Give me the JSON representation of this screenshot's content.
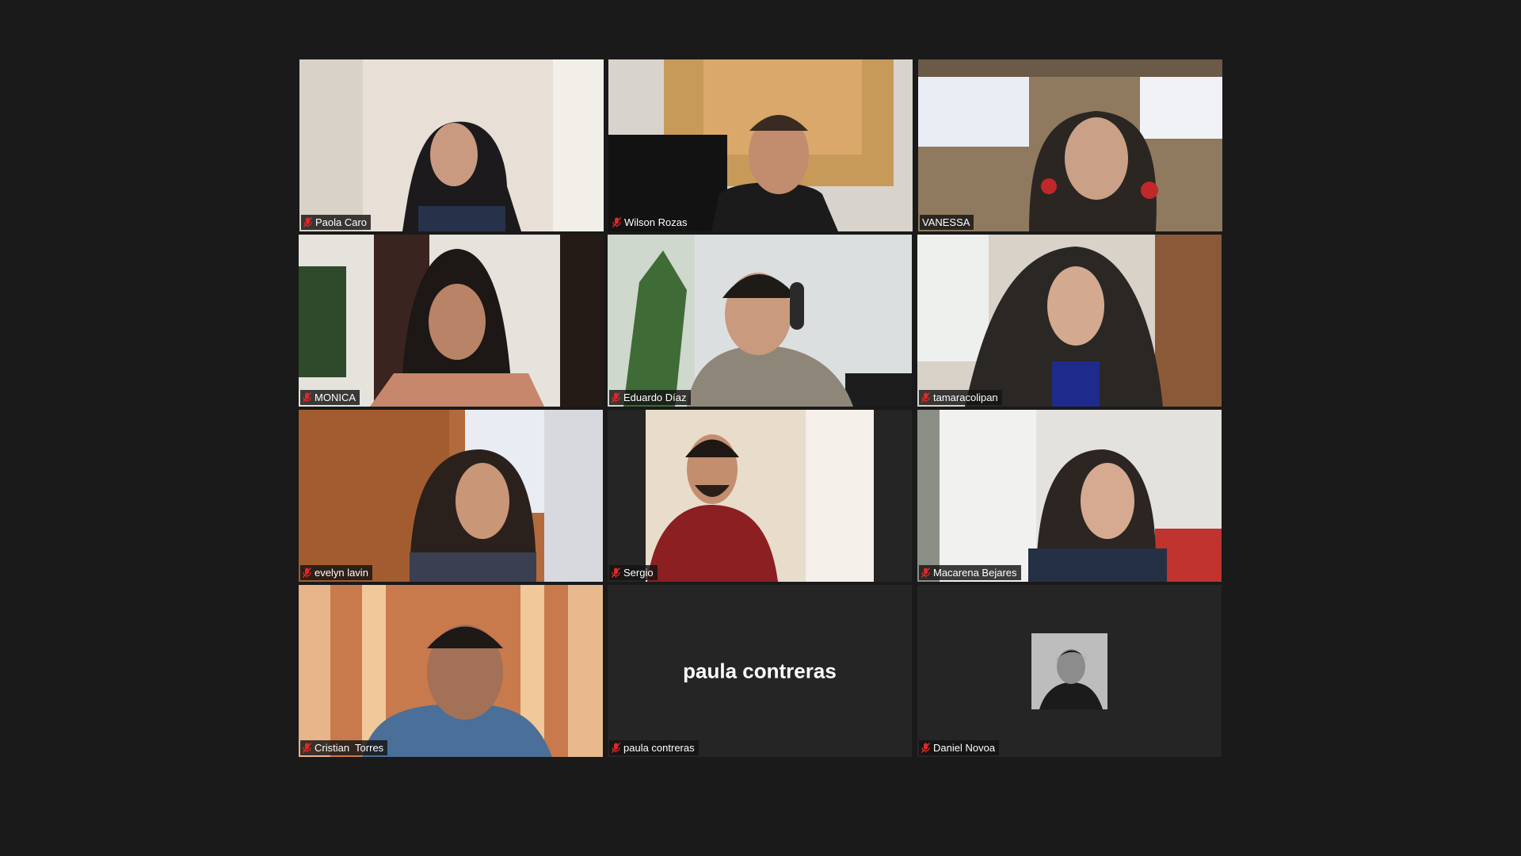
{
  "participants": [
    {
      "name": "Paola Caro",
      "muted": true,
      "video": true
    },
    {
      "name": "Wilson Rozas",
      "muted": true,
      "video": true
    },
    {
      "name": "VANESSA",
      "muted": false,
      "video": true
    },
    {
      "name": "MONICA",
      "muted": true,
      "video": true
    },
    {
      "name": "Eduardo Díaz",
      "muted": true,
      "video": true
    },
    {
      "name": "tamaracolipan",
      "muted": true,
      "video": true
    },
    {
      "name": "evelyn lavin",
      "muted": true,
      "video": true
    },
    {
      "name": "Sergio",
      "muted": true,
      "video": true
    },
    {
      "name": "Macarena Bejares",
      "muted": true,
      "video": true
    },
    {
      "name": "Cristian  Torres",
      "muted": true,
      "video": true
    },
    {
      "name": "paula contreras",
      "muted": true,
      "video": false,
      "display_text": "paula contreras"
    },
    {
      "name": "Daniel Novoa",
      "muted": true,
      "video": false,
      "avatar": true
    }
  ],
  "icons": {
    "muted": "mic-muted-icon"
  },
  "colors": {
    "background": "#1a1a1a",
    "tile_bg": "#252525",
    "muted_red": "#e02828"
  }
}
